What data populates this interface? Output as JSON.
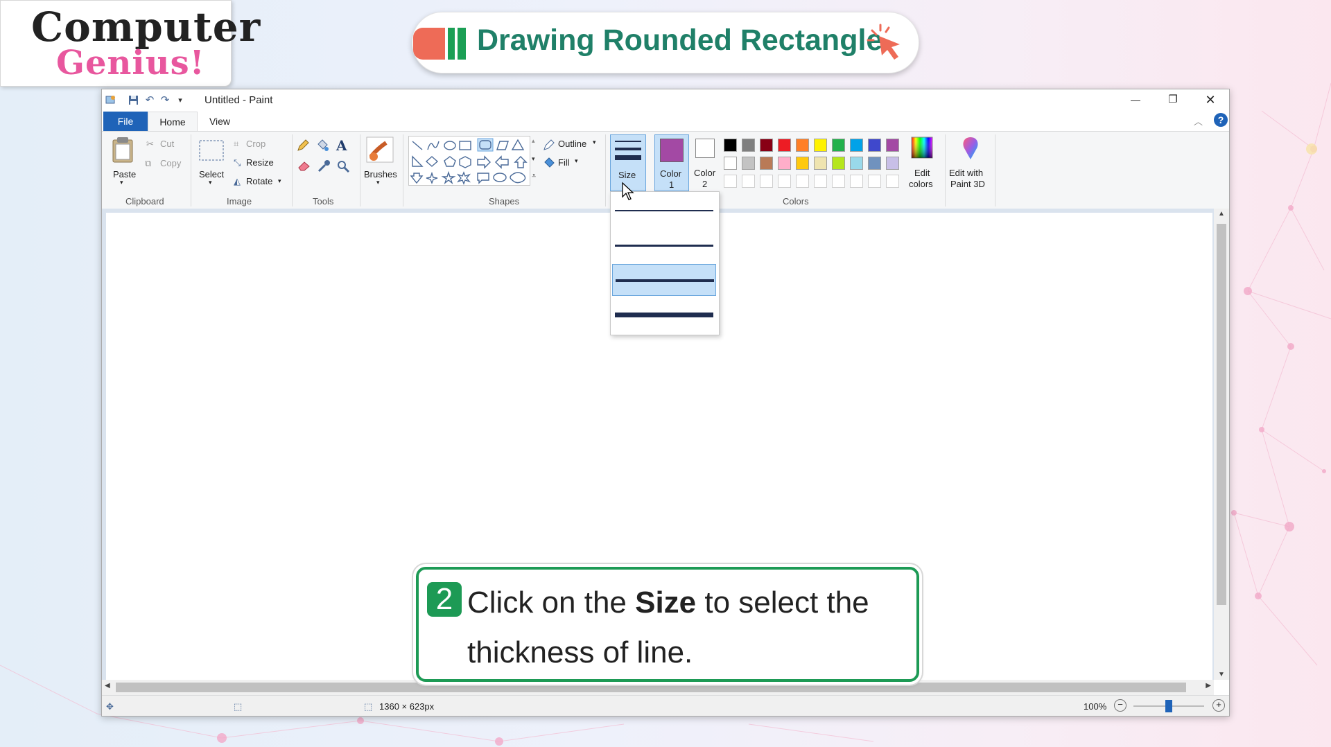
{
  "logo": {
    "line1": "Computer",
    "line2": "Genius!"
  },
  "header": {
    "title": "Drawing Rounded Rectangle"
  },
  "window": {
    "title": "Untitled - Paint",
    "controls": {
      "minimize": "—",
      "restore": "❐",
      "close": "✕"
    }
  },
  "tabs": {
    "file": "File",
    "home": "Home",
    "view": "View"
  },
  "ribbon": {
    "clipboard": {
      "paste": "Paste",
      "cut": "Cut",
      "copy": "Copy",
      "label": "Clipboard"
    },
    "image": {
      "select": "Select",
      "crop": "Crop",
      "resize": "Resize",
      "rotate": "Rotate",
      "label": "Image"
    },
    "tools": {
      "label": "Tools"
    },
    "brushes": {
      "label": "Brushes"
    },
    "shapes": {
      "outline": "Outline",
      "fill": "Fill",
      "label": "Shapes"
    },
    "size": {
      "label": "Size"
    },
    "colors": {
      "color1_line1": "Color",
      "color1_line2": "1",
      "color2_line1": "Color",
      "color2_line2": "2",
      "edit_line1": "Edit",
      "edit_line2": "colors",
      "paint3d_line1": "Edit with",
      "paint3d_line2": "Paint 3D",
      "label": "Colors",
      "color1_value": "#a349a4",
      "color2_value": "#ffffff",
      "palette_row1": [
        "#000000",
        "#7f7f7f",
        "#880015",
        "#ed1c24",
        "#ff7f27",
        "#fff200",
        "#22b14c",
        "#00a2e8",
        "#3f48cc",
        "#a349a4"
      ],
      "palette_row2": [
        "#ffffff",
        "#c3c3c3",
        "#b97a57",
        "#ffaec9",
        "#ffc90e",
        "#efe4b0",
        "#b5e61d",
        "#99d9ea",
        "#7092be",
        "#c8bfe7"
      ]
    }
  },
  "size_dropdown": {
    "options": [
      "1px",
      "3px",
      "5px",
      "8px"
    ],
    "selected_index": 2
  },
  "statusbar": {
    "dimensions": "1360 × 623px",
    "zoom": "100%",
    "zoom_level": 0.5
  },
  "instruction": {
    "step": "2",
    "text_before": "Click on the ",
    "text_bold": "Size",
    "text_after": " to select the thickness of line."
  }
}
